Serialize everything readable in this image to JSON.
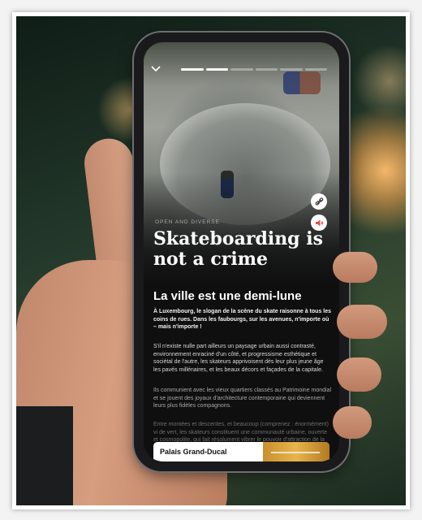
{
  "app": {
    "story_progress": {
      "segments": 6,
      "current": 2
    }
  },
  "article": {
    "kicker": "OPEN AND DIVERSE",
    "headline": "Skateboarding is not a crime",
    "subhead": "La ville est une demi-lune",
    "lead": "À Luxembourg, le slogan de la scène du skate raisonne à tous les coins de rues. Dans les faubourgs, sur les avenues, n'importe où – mais n'importe !",
    "paragraphs": [
      "S'il n'existe nulle part ailleurs un paysage urbain aussi contrasté, environnement enraciné d'un côté, et progressisme esthétique et sociétal de l'autre, les skateurs apprivoisent dès leur plus jeune âge les pavés millénaires, et les beaux décors et façades de la capitale.",
      "Ils communient avec les vieux quartiers classés au Patrimoine mondial et se jouent des joyaux d'architecture contemporaine qui deviennent leurs plus fidèles compagnons.",
      "Entre montées et descentes, et beaucoup (comprenez : énormément) vi de vert, les skateurs constituent une communauté urbaine, ouverte et cosmopolite, qui fait résolument vibrer le pouvoir d'attraction de la ville."
    ],
    "card_title": "Palais Grand-Ducal"
  },
  "icons": {
    "collapse": "chevron-down-icon",
    "share": "link-icon",
    "sound": "speaker-muted-icon"
  },
  "colors": {
    "accent": "#e0524a",
    "text": "#ffffff",
    "background": "#0f0f10"
  }
}
